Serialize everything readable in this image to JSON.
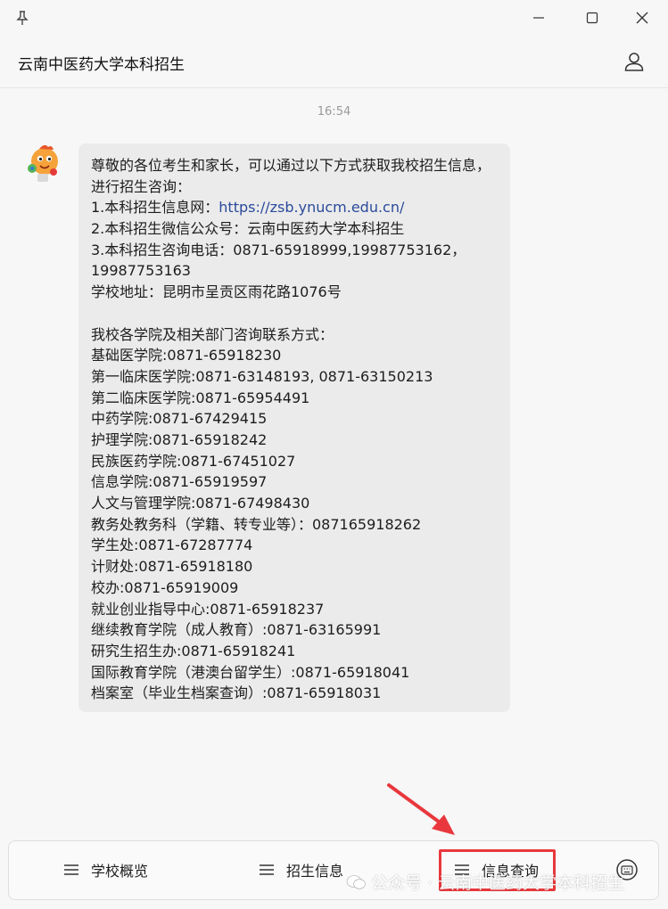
{
  "window": {
    "pin_icon": "pin-icon",
    "minimize_icon": "minimize-icon",
    "maximize_icon": "maximize-icon",
    "close_icon": "close-icon"
  },
  "header": {
    "title": "云南中医药大学本科招生",
    "profile_icon": "person-icon"
  },
  "chat": {
    "timestamp": "16:54",
    "message": {
      "intro": "尊敬的各位考生和家长，可以通过以下方式获取我校招生信息，进行招生咨询：",
      "website_label": "1.本科招生信息网：",
      "website_url": "https://zsb.ynucm.edu.cn/",
      "wechat": "2.本科招生微信公众号：云南中医药大学本科招生",
      "phone": "3.本科招生咨询电话：0871-65918999,19987753162，19987753163",
      "address": "学校地址：昆明市呈贡区雨花路1076号",
      "contacts_heading": "我校各学院及相关部门咨询联系方式：",
      "contacts": [
        "基础医学院:0871-65918230",
        "第一临床医学院:0871-63148193, 0871-63150213",
        "第二临床医学院:0871-65954491",
        "中药学院:0871-67429415",
        "护理学院:0871-65918242",
        "民族医药学院:0871-67451027",
        "信息学院:0871-65919597",
        "人文与管理学院:0871-67498430",
        "教务处教务科（学籍、转专业等）：087165918262",
        "学生处:0871-67287774",
        "计财处:0871-65918180",
        "校办:0871-65919009",
        "就业创业指导中心:0871-65918237",
        "继续教育学院（成人教育）:0871-63165991",
        "研究生招生办:0871-65918241",
        "国际教育学院（港澳台留学生）:0871-65918041",
        "档案室（毕业生档案查询）:0871-65918031"
      ]
    }
  },
  "menu": {
    "items": [
      {
        "label": "学校概览",
        "icon": "menu-lines-icon"
      },
      {
        "label": "招生信息",
        "icon": "menu-lines-icon"
      },
      {
        "label": "信息查询",
        "icon": "menu-lines-icon"
      }
    ],
    "keyboard_icon": "keyboard-icon"
  },
  "annotation": {
    "color": "#e8383d"
  },
  "watermark": {
    "text": "公众号 · 云南中医药大学本科招生"
  }
}
